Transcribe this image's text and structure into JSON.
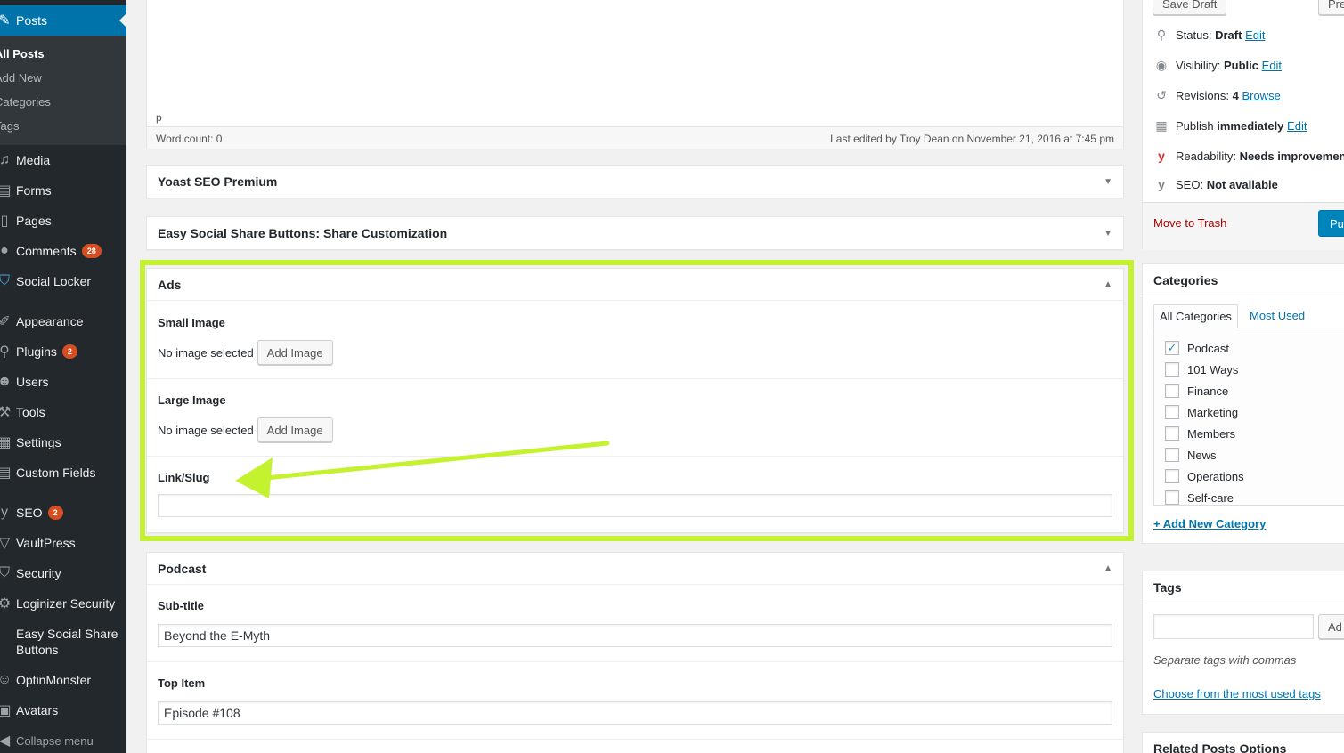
{
  "sidebar": {
    "posts": "Posts",
    "submenu": [
      "All Posts",
      "Add New",
      "Categories",
      "Tags"
    ],
    "items": [
      {
        "label": "Media",
        "icon": "media-icon"
      },
      {
        "label": "Forms",
        "icon": "forms-icon"
      },
      {
        "label": "Pages",
        "icon": "pages-icon"
      },
      {
        "label": "Comments",
        "icon": "comments-icon",
        "badge": "28"
      },
      {
        "label": "Social Locker",
        "icon": "social-locker-icon"
      },
      {
        "label": "Appearance",
        "icon": "appearance-icon"
      },
      {
        "label": "Plugins",
        "icon": "plugins-icon",
        "badge": "2"
      },
      {
        "label": "Users",
        "icon": "users-icon"
      },
      {
        "label": "Tools",
        "icon": "tools-icon"
      },
      {
        "label": "Settings",
        "icon": "settings-icon"
      },
      {
        "label": "Custom Fields",
        "icon": "custom-fields-icon"
      },
      {
        "label": "SEO",
        "icon": "seo-icon",
        "badge": "2"
      },
      {
        "label": "VaultPress",
        "icon": "vaultpress-icon"
      },
      {
        "label": "Security",
        "icon": "security-icon"
      },
      {
        "label": "Loginizer Security",
        "icon": "loginizer-icon"
      },
      {
        "label": "Easy Social Share Buttons",
        "icon": "share-icon"
      },
      {
        "label": "OptinMonster",
        "icon": "optinmonster-icon"
      },
      {
        "label": "Avatars",
        "icon": "avatars-icon"
      }
    ],
    "collapse": "Collapse menu"
  },
  "editor": {
    "path": "p",
    "word_count": "Word count: 0",
    "last_edited": "Last edited by Troy Dean on November 21, 2016 at 7:45 pm"
  },
  "boxes": {
    "yoast": "Yoast SEO Premium",
    "essb": "Easy Social Share Buttons: Share Customization"
  },
  "ads": {
    "title": "Ads",
    "small_label": "Small Image",
    "large_label": "Large Image",
    "no_image": "No image selected",
    "add_image": "Add Image",
    "link_label": "Link/Slug",
    "link_value": ""
  },
  "podcast": {
    "title": "Podcast",
    "subtitle_label": "Sub-title",
    "subtitle_value": "Beyond the E-Myth",
    "top_label": "Top Item",
    "top_value": "Episode #108"
  },
  "publish": {
    "save_draft": "Save Draft",
    "preview": "Pre",
    "status_label": "Status:",
    "status_value": "Draft",
    "visibility_label": "Visibility:",
    "visibility_value": "Public",
    "revisions_label": "Revisions:",
    "revisions_value": "4",
    "browse": "Browse",
    "publish_label": "Publish",
    "publish_value": "immediately",
    "edit": "Edit",
    "readability_label": "Readability:",
    "readability_value": "Needs improvemen",
    "seo_label": "SEO:",
    "seo_value": "Not available",
    "trash": "Move to Trash",
    "publish_button": "Pu"
  },
  "categories": {
    "title": "Categories",
    "tab_all": "All Categories",
    "tab_most": "Most Used",
    "items": [
      {
        "label": "Podcast",
        "checked": true
      },
      {
        "label": "101 Ways",
        "checked": false
      },
      {
        "label": "Finance",
        "checked": false
      },
      {
        "label": "Marketing",
        "checked": false
      },
      {
        "label": "Members",
        "checked": false
      },
      {
        "label": "News",
        "checked": false
      },
      {
        "label": "Operations",
        "checked": false
      },
      {
        "label": "Self-care",
        "checked": false
      }
    ],
    "add_new": "+ Add New Category"
  },
  "tags": {
    "title": "Tags",
    "add_button": "Ad",
    "hint": "Separate tags with commas",
    "choose": "Choose from the most used tags"
  },
  "related": {
    "title": "Related Posts Options"
  },
  "colors": {
    "highlight": "#c5f22e",
    "wp_blue": "#0073aa",
    "badge": "#d54e21"
  }
}
